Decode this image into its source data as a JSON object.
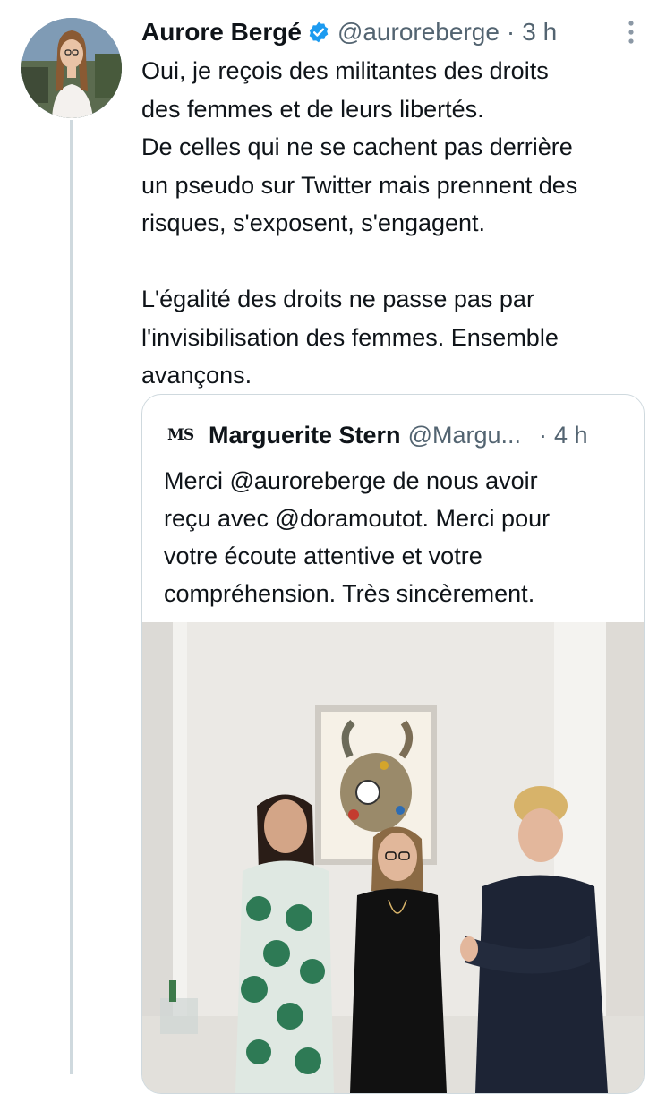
{
  "tweet": {
    "author_name": "Aurore Bergé",
    "handle": "@auroreberge",
    "separator": "·",
    "time": "3 h",
    "lines": [
      "Oui, je reçois des militantes des droits",
      "des femmes et de leurs libertés.",
      "De celles qui ne se cachent pas derrière",
      "un pseudo sur Twitter mais prennent des",
      "risques, s'exposent, s'engagent.",
      "L'égalité des droits ne passe pas par",
      "l'invisibilisation des femmes. Ensemble",
      "avançons."
    ]
  },
  "quoted_tweet": {
    "logo_text": "MS",
    "author_name": "Marguerite Stern",
    "handle": "@Margu...",
    "separator": "·",
    "time": "4 h",
    "lines": [
      "Merci @auroreberge de nous avoir",
      "reçu avec @doramoutot. Merci pour",
      "votre écoute attentive et votre",
      "compréhension. Très sincèrement."
    ]
  },
  "icons": {
    "verified": "verified-badge-icon",
    "more": "more-options-icon"
  },
  "colors": {
    "text": "#0f1419",
    "secondary": "#536471",
    "verified": "#1d9bf0",
    "border": "#cfd9de"
  }
}
